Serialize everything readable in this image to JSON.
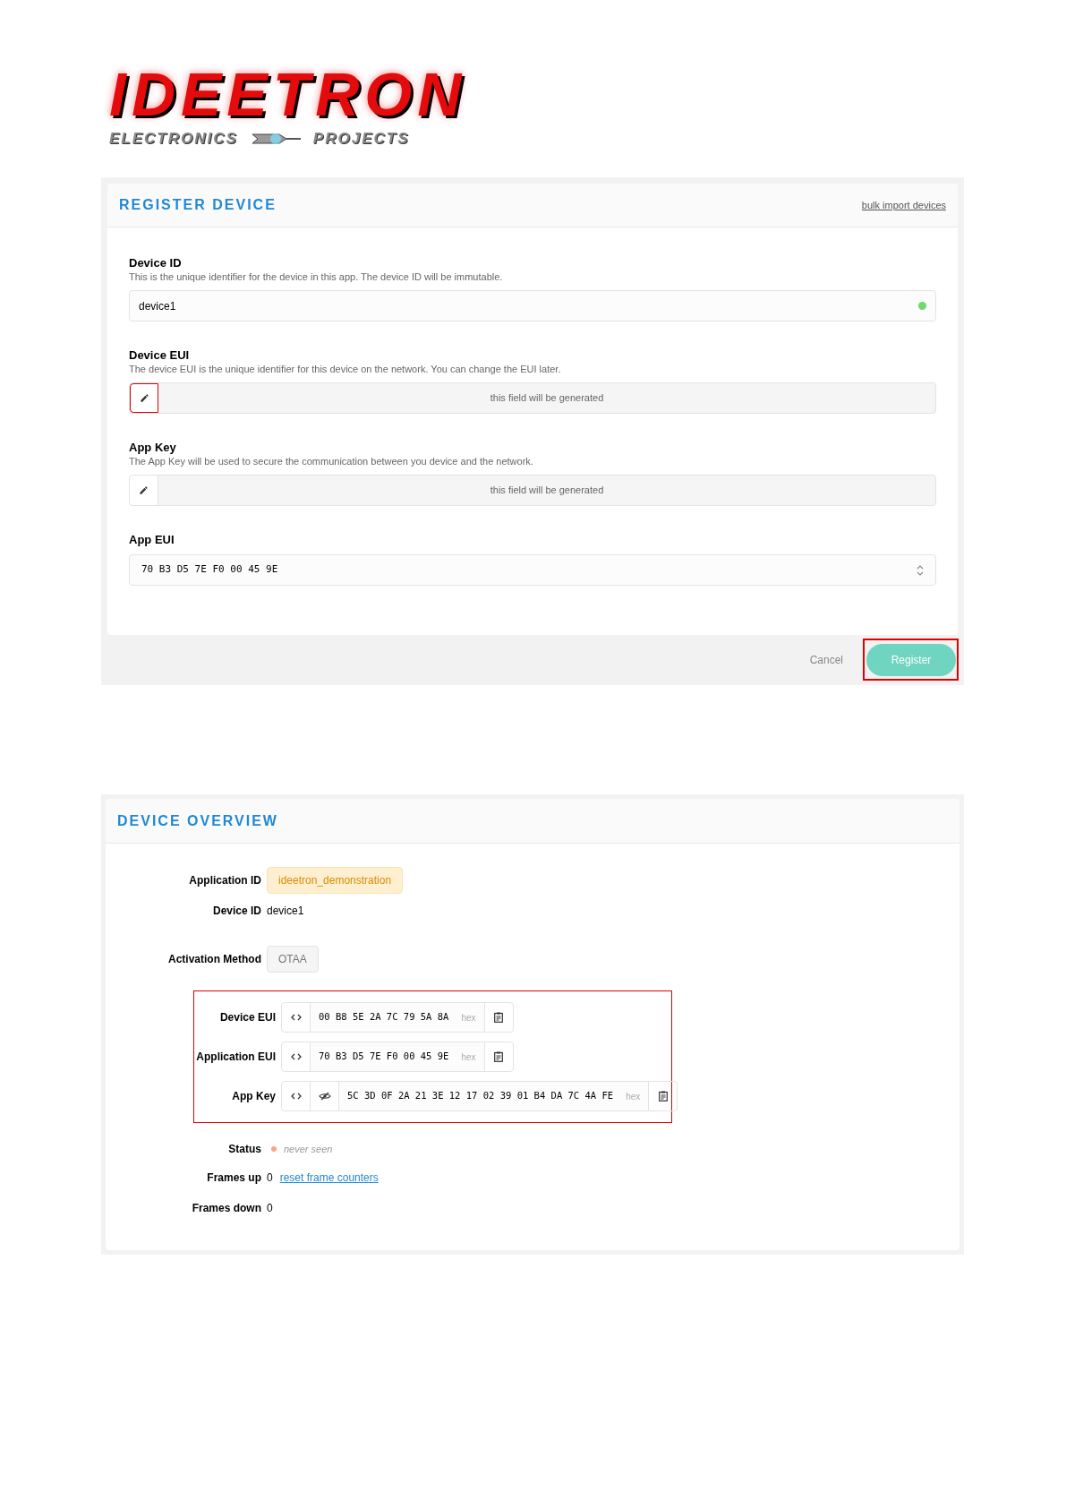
{
  "logo": {
    "title": "IDEETRON",
    "left_tagline": "ELECTRONICS",
    "right_tagline": "PROJECTS"
  },
  "register": {
    "title": "REGISTER DEVICE",
    "bulk_link": "bulk import devices",
    "fields": [
      {
        "kind": "text",
        "label": "Device ID",
        "description": "This is the unique identifier for the device in this app. The device ID will be immutable.",
        "value": "device1",
        "valid": true
      },
      {
        "kind": "generated",
        "label": "Device EUI",
        "description": "The device EUI is the unique identifier for this device on the network. You can change the EUI later.",
        "placeholder": "this field will be generated",
        "highlighted": true
      },
      {
        "kind": "generated",
        "label": "App Key",
        "description": "The App Key will be used to secure the communication between you device and the network.",
        "placeholder": "this field will be generated",
        "highlighted": false
      },
      {
        "kind": "select",
        "label": "App EUI",
        "value": "70 B3 D5 7E F0 00 45 9E"
      }
    ],
    "cancel": "Cancel",
    "submit": {
      "label": "Register",
      "highlighted": true
    }
  },
  "overview": {
    "title": "DEVICE OVERVIEW",
    "rows": [
      {
        "kind": "badge",
        "label": "Application ID",
        "value": "ideetron_demonstration",
        "color": "#fdefcf"
      },
      {
        "kind": "plain",
        "label": "Device ID",
        "value": "device1"
      },
      {
        "kind": "badge",
        "label": "Activation Method",
        "value": "OTAA",
        "color": "#f5f5f5"
      }
    ],
    "keys_highlighted": true,
    "keys": [
      {
        "label": "Device EUI",
        "value": "00 B8 5E 2A 7C 79 5A 8A",
        "unit": "hex",
        "secret": false
      },
      {
        "label": "Application EUI",
        "value": "70 B3 D5 7E F0 00 45 9E",
        "unit": "hex",
        "secret": false
      },
      {
        "label": "App Key",
        "value": "5C 3D 0F 2A 21 3E 12 17 02 39 01 B4 DA 7C 4A FE",
        "unit": "hex",
        "secret": true
      }
    ],
    "status": {
      "label": "Status",
      "value": "never seen",
      "color": "#f8a58a"
    },
    "frames_up": {
      "label": "Frames up",
      "value": "0",
      "link": "reset frame counters"
    },
    "frames_down": {
      "label": "Frames down",
      "value": "0"
    }
  }
}
